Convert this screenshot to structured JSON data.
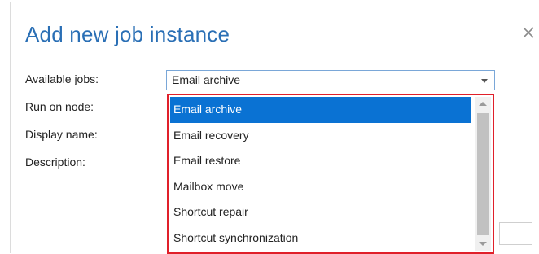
{
  "dialog": {
    "title": "Add new job instance"
  },
  "form": {
    "labels": [
      "Available jobs:",
      "Run on node:",
      "Display name:",
      "Description:"
    ],
    "available_jobs_value": "Email archive"
  },
  "dropdown": {
    "options": [
      "Email archive",
      "Email recovery",
      "Email restore",
      "Mailbox move",
      "Shortcut repair",
      "Shortcut synchronization"
    ],
    "selected": "Email archive"
  },
  "colors": {
    "title": "#2a6fb5",
    "highlight": "#0a72d3",
    "outline": "#e0202a"
  },
  "icons": {
    "close": "close-icon",
    "select_arrow": "chevron-down-icon"
  }
}
